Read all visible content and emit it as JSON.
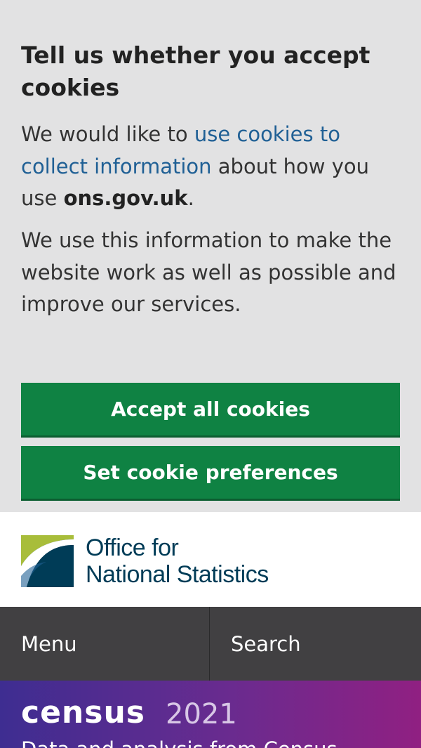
{
  "cookie_banner": {
    "title": "Tell us whether you accept cookies",
    "paragraph1": {
      "prefix": "We would like to ",
      "link_text": "use cookies to collect information",
      "middle": " about how you use ",
      "bold": "ons.gov.uk",
      "suffix": "."
    },
    "paragraph2": "We use this information to make the website work as well as possible and improve our services.",
    "accept_button": "Accept all cookies",
    "preferences_button": "Set cookie preferences"
  },
  "header": {
    "logo_line1": "Office for",
    "logo_line2": "National Statistics"
  },
  "nav": {
    "menu_label": "Menu",
    "search_label": "Search"
  },
  "census_banner": {
    "word": "census",
    "year": "2021",
    "subtitle": "Data and analysis from Census"
  },
  "colors": {
    "link": "#206095",
    "button": "#0f8243",
    "nav_background": "#414042",
    "logo_navy": "#003c57",
    "logo_green": "#a8bd3a"
  }
}
